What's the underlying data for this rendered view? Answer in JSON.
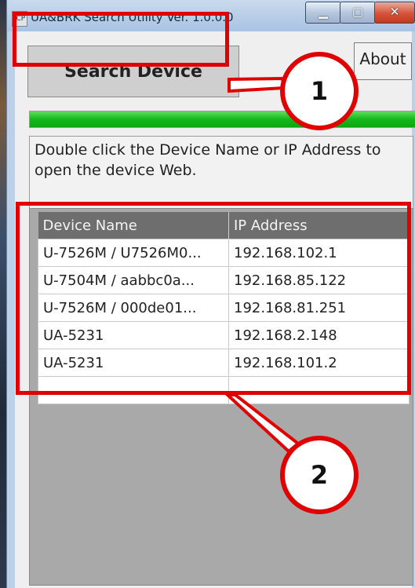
{
  "window": {
    "title": "UA&BRK Search Utility  Ver. 1.0.0.0"
  },
  "toolbar": {
    "search_label": "Search Device",
    "about_label": "About"
  },
  "progress": {
    "fraction": 1.0
  },
  "instruction": {
    "text": "Double click the Device Name or IP Address to open the device Web."
  },
  "table": {
    "headers": [
      "Device Name",
      "IP Address"
    ],
    "rows": [
      [
        "U-7526M / U7526M0...",
        "192.168.102.1"
      ],
      [
        "U-7504M / aabbc0a...",
        "192.168.85.122"
      ],
      [
        "U-7526M / 000de01...",
        "192.168.81.251"
      ],
      [
        "UA-5231",
        "192.168.2.148"
      ],
      [
        "UA-5231",
        "192.168.101.2"
      ],
      [
        "",
        ""
      ]
    ]
  },
  "callouts": {
    "one": "1",
    "two": "2"
  },
  "colors": {
    "highlight": "#e00000",
    "progress": "#12b81a"
  }
}
